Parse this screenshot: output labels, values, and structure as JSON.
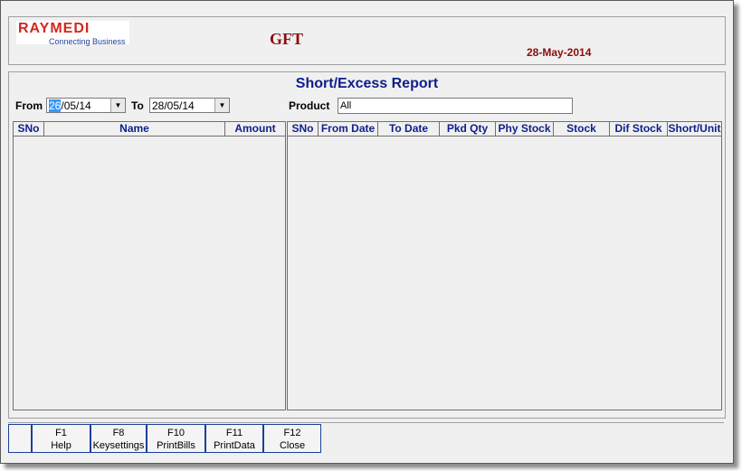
{
  "header": {
    "logo": "RAYMEDI",
    "tagline": "Connecting Business",
    "company": "GFT",
    "date": "28-May-2014"
  },
  "report": {
    "title": "Short/Excess Report"
  },
  "filters": {
    "from_label": "From",
    "from_day": "26",
    "from_rest": "/05/14",
    "to_label": "To",
    "to_value": "28/05/14",
    "product_label": "Product",
    "product_value": "All"
  },
  "left_grid": {
    "columns": [
      "SNo",
      "Name",
      "Amount"
    ]
  },
  "right_grid": {
    "columns": [
      "SNo",
      "From Date",
      "To Date",
      "Pkd Qty",
      "Phy Stock",
      "Stock",
      "Dif Stock",
      "Short/Unit"
    ]
  },
  "footer": {
    "keys": [
      {
        "key": "F1",
        "label": "Help"
      },
      {
        "key": "F8",
        "label": "Keysettings"
      },
      {
        "key": "F10",
        "label": "PrintBills"
      },
      {
        "key": "F11",
        "label": "PrintData"
      },
      {
        "key": "F12",
        "label": "Close"
      }
    ]
  },
  "icons": {
    "dropdown": "chevron-down-icon"
  },
  "colors": {
    "logo_red": "#d4271c",
    "title_blue": "#0d1e8c",
    "header_maroon": "#8b0d0d"
  }
}
